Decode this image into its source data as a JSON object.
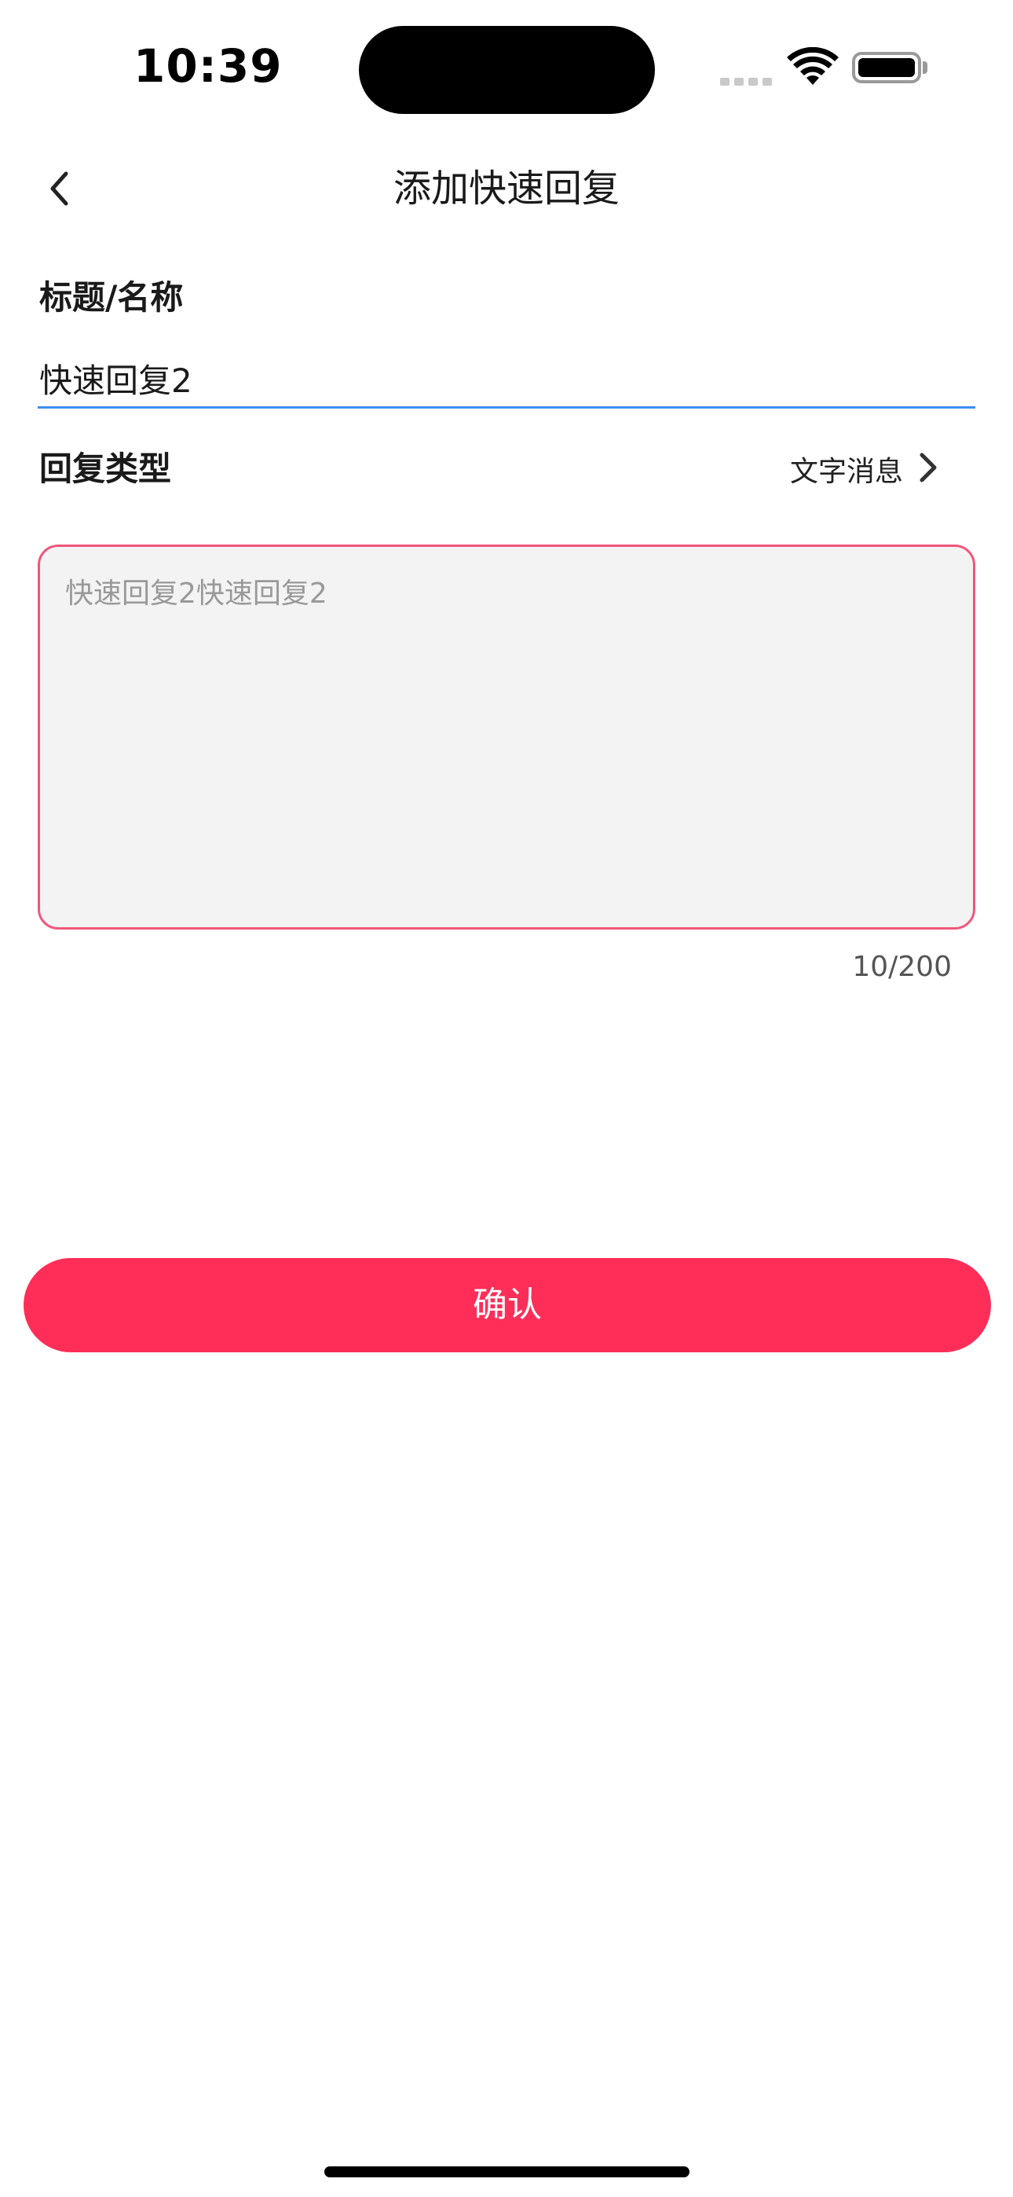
{
  "status_bar": {
    "time": "10:39",
    "icons": [
      "cellular-signal-icon",
      "wifi-icon",
      "battery-icon"
    ]
  },
  "nav": {
    "back_icon": "chevron-left-icon",
    "title": "添加快速回复"
  },
  "form": {
    "title_label": "标题/名称",
    "title_value": "快速回复2",
    "type_label": "回复类型",
    "type_value": "文字消息",
    "type_icon": "chevron-right-icon",
    "content_value": "快速回复2快速回复2",
    "char_count": "10/200"
  },
  "actions": {
    "confirm_label": "确认"
  },
  "colors": {
    "accent": "#fe2e58",
    "input_focus_line": "#3d8ef0",
    "textarea_border": "#f0567a",
    "textarea_bg": "#f3f3f3"
  }
}
